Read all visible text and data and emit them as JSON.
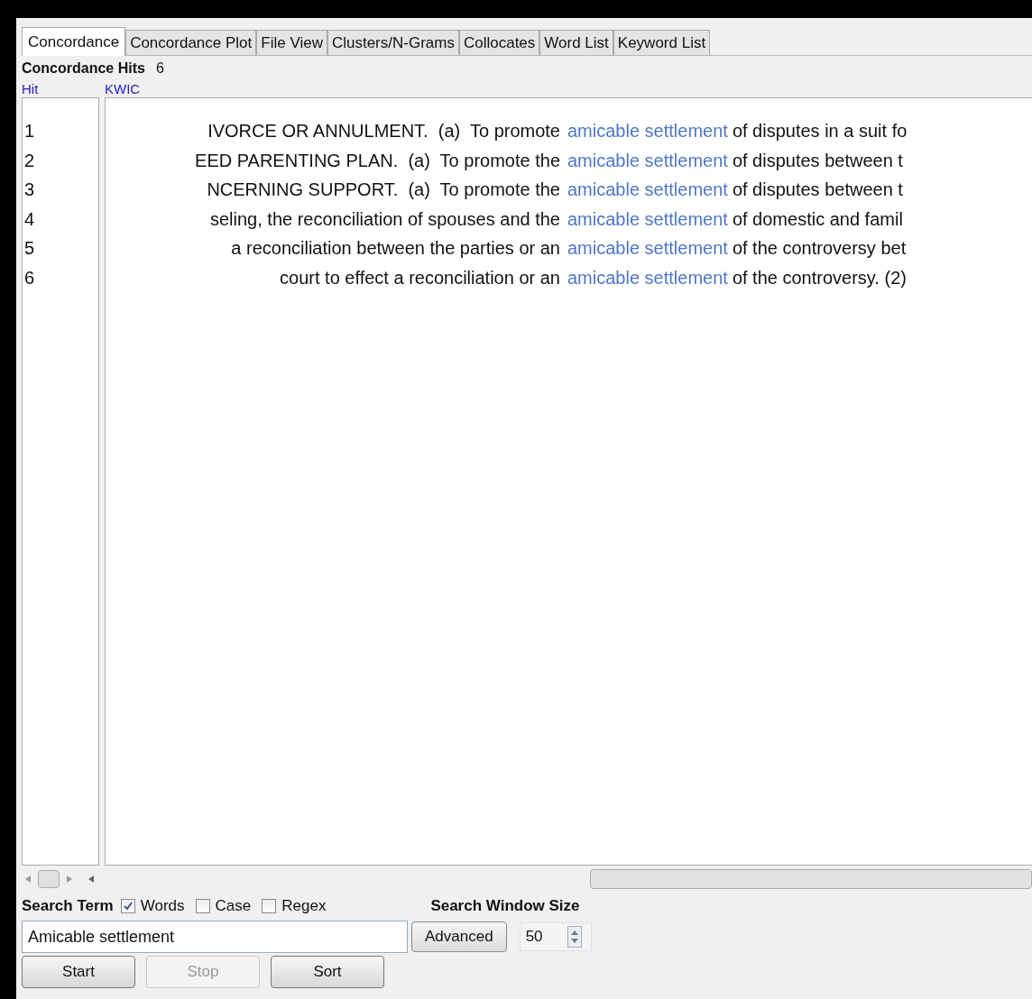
{
  "tabs": [
    {
      "label": "Concordance",
      "selected": true
    },
    {
      "label": "Concordance Plot",
      "selected": false
    },
    {
      "label": "File View",
      "selected": false
    },
    {
      "label": "Clusters/N-Grams",
      "selected": false
    },
    {
      "label": "Collocates",
      "selected": false
    },
    {
      "label": "Word List",
      "selected": false
    },
    {
      "label": "Keyword List",
      "selected": false
    }
  ],
  "hits": {
    "label": "Concordance Hits",
    "count": "6"
  },
  "columns": [
    "Hit",
    "KWIC"
  ],
  "rows": [
    {
      "hit": "1",
      "left": "IVORCE OR ANNULMENT.  (a)  To promote",
      "keyword": "amicable settlement",
      "right": "of disputes in a suit fo"
    },
    {
      "hit": "2",
      "left": "EED PARENTING PLAN.  (a)  To promote the",
      "keyword": "amicable settlement",
      "right": "of disputes between t"
    },
    {
      "hit": "3",
      "left": "NCERNING SUPPORT.  (a)  To promote the",
      "keyword": "amicable settlement",
      "right": "of disputes between t"
    },
    {
      "hit": "4",
      "left": "seling, the reconciliation of spouses and the",
      "keyword": "amicable settlement",
      "right": "of domestic and famil"
    },
    {
      "hit": "5",
      "left": "a reconciliation between the parties or an",
      "keyword": "amicable settlement",
      "right": "of the controversy bet"
    },
    {
      "hit": "6",
      "left": "court to effect a reconciliation or an",
      "keyword": "amicable settlement",
      "right": "of the controversy. (2)"
    }
  ],
  "search": {
    "label": "Search Term",
    "options": [
      {
        "label": "Words",
        "checked": true
      },
      {
        "label": "Case",
        "checked": false
      },
      {
        "label": "Regex",
        "checked": false
      }
    ],
    "value": "Amicable settlement",
    "advanced": "Advanced"
  },
  "window_size": {
    "label": "Search Window Size",
    "value": "50"
  },
  "buttons": [
    {
      "label": "Start",
      "disabled": false
    },
    {
      "label": "Stop",
      "disabled": true
    },
    {
      "label": "Sort",
      "disabled": false
    }
  ]
}
